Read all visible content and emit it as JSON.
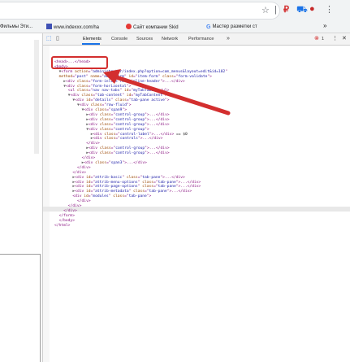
{
  "browser": {
    "bookmarks": [
      {
        "label": "Фильмы Эти..."
      },
      {
        "label": "www.indexxx.com/ha"
      },
      {
        "label": "Сайт компании Skid"
      },
      {
        "label": "Мастер разметки ст"
      }
    ],
    "more": "»"
  },
  "devtools": {
    "tabs": [
      "Elements",
      "Console",
      "Sources",
      "Network",
      "Performance",
      "»"
    ],
    "error_count": "1",
    "dom_lines": [
      {
        "i": 0,
        "parts": [
          [
            "tg",
            "<head>...</head>"
          ]
        ]
      },
      {
        "i": 0,
        "parts": [
          [
            "tg",
            "<body>"
          ]
        ]
      },
      {
        "i": 1,
        "parts": [
          [
            "arr",
            "▼"
          ],
          [
            "tg",
            "<form "
          ],
          [
            "an",
            "action"
          ],
          [
            "tg",
            "=\""
          ],
          [
            "av",
            "administrator/index.php?option=com_menus&layout=edit&id=102"
          ],
          [
            "tg",
            "\""
          ]
        ]
      },
      {
        "i": 1,
        "parts": [
          [
            "an",
            "method"
          ],
          [
            "tg",
            "=\""
          ],
          [
            "av",
            "post"
          ],
          [
            "tg",
            "\" "
          ],
          [
            "an",
            "name"
          ],
          [
            "tg",
            "=\""
          ],
          [
            "av",
            "adminForm"
          ],
          [
            "tg",
            "\" "
          ],
          [
            "an",
            "id"
          ],
          [
            "tg",
            "=\""
          ],
          [
            "av",
            "item-form"
          ],
          [
            "tg",
            "\" "
          ],
          [
            "an",
            "class"
          ],
          [
            "tg",
            "=\""
          ],
          [
            "av",
            "form-validate"
          ],
          [
            "tg",
            "\">"
          ]
        ]
      },
      {
        "i": 2,
        "parts": [
          [
            "arr",
            "▶"
          ],
          [
            "tg",
            "<div "
          ],
          [
            "an",
            "class"
          ],
          [
            "tg",
            "=\""
          ],
          [
            "av",
            "form-inline form-inline-header"
          ],
          [
            "tg",
            "\">...</div>"
          ]
        ]
      },
      {
        "i": 2,
        "parts": [
          [
            "arr",
            "▼"
          ],
          [
            "tg",
            "<div "
          ],
          [
            "an",
            "class"
          ],
          [
            "tg",
            "=\""
          ],
          [
            "av",
            "form-horizontal"
          ],
          [
            "tg",
            "\">"
          ]
        ]
      },
      {
        "i": 3,
        "parts": [
          [
            "tg",
            "<ul "
          ],
          [
            "an",
            "class"
          ],
          [
            "tg",
            "=\""
          ],
          [
            "av",
            "nav nav-tabs"
          ],
          [
            "tg",
            "\" "
          ],
          [
            "an",
            "id"
          ],
          [
            "tg",
            "=\""
          ],
          [
            "av",
            "myTabTabs"
          ],
          [
            "tg",
            "\"></ul>"
          ]
        ]
      },
      {
        "i": 3,
        "parts": [
          [
            "arr",
            "▼"
          ],
          [
            "tg",
            "<div "
          ],
          [
            "an",
            "class"
          ],
          [
            "tg",
            "=\""
          ],
          [
            "av",
            "tab-content"
          ],
          [
            "tg",
            "\" "
          ],
          [
            "an",
            "id"
          ],
          [
            "tg",
            "=\""
          ],
          [
            "av",
            "myTabContent"
          ],
          [
            "tg",
            "\">"
          ]
        ]
      },
      {
        "i": 4,
        "parts": [
          [
            "arr",
            "▼"
          ],
          [
            "tg",
            "<div "
          ],
          [
            "an",
            "id"
          ],
          [
            "tg",
            "=\""
          ],
          [
            "av",
            "details"
          ],
          [
            "tg",
            "\" "
          ],
          [
            "an",
            "class"
          ],
          [
            "tg",
            "=\""
          ],
          [
            "av",
            "tab-pane active"
          ],
          [
            "tg",
            "\">"
          ]
        ]
      },
      {
        "i": 5,
        "parts": [
          [
            "arr",
            "▼"
          ],
          [
            "tg",
            "<div "
          ],
          [
            "an",
            "class"
          ],
          [
            "tg",
            "=\""
          ],
          [
            "av",
            "row-fluid"
          ],
          [
            "tg",
            "\">"
          ]
        ]
      },
      {
        "i": 6,
        "parts": [
          [
            "arr",
            "▼"
          ],
          [
            "tg",
            "<div "
          ],
          [
            "an",
            "class"
          ],
          [
            "tg",
            "=\""
          ],
          [
            "av",
            "span9"
          ],
          [
            "tg",
            "\">"
          ]
        ]
      },
      {
        "i": 7,
        "parts": [
          [
            "arr",
            "▶"
          ],
          [
            "tg",
            "<div "
          ],
          [
            "an",
            "class"
          ],
          [
            "tg",
            "=\""
          ],
          [
            "av",
            "control-group"
          ],
          [
            "tg",
            "\">...</div>"
          ]
        ]
      },
      {
        "i": 7,
        "parts": [
          [
            "arr",
            "▶"
          ],
          [
            "tg",
            "<div "
          ],
          [
            "an",
            "class"
          ],
          [
            "tg",
            "=\""
          ],
          [
            "av",
            "control-group"
          ],
          [
            "tg",
            "\">...</div>"
          ]
        ]
      },
      {
        "i": 7,
        "parts": [
          [
            "arr",
            "▶"
          ],
          [
            "tg",
            "<div "
          ],
          [
            "an",
            "class"
          ],
          [
            "tg",
            "=\""
          ],
          [
            "av",
            "control-group"
          ],
          [
            "tg",
            "\">...</div>"
          ]
        ]
      },
      {
        "i": 7,
        "parts": [
          [
            "arr",
            "▼"
          ],
          [
            "tg",
            "<div "
          ],
          [
            "an",
            "class"
          ],
          [
            "tg",
            "=\""
          ],
          [
            "av",
            "control-group"
          ],
          [
            "tg",
            "\">"
          ]
        ]
      },
      {
        "i": 8,
        "parts": [
          [
            "arr",
            "▶"
          ],
          [
            "tg",
            "<div "
          ],
          [
            "an",
            "class"
          ],
          [
            "tg",
            "=\""
          ],
          [
            "av",
            "control-label"
          ],
          [
            "tg",
            "\">...</div>"
          ],
          [
            "tx",
            " == $0"
          ]
        ]
      },
      {
        "i": 8,
        "parts": [
          [
            "arr",
            "▶"
          ],
          [
            "tg",
            "<div "
          ],
          [
            "an",
            "class"
          ],
          [
            "tg",
            "=\""
          ],
          [
            "av",
            "controls"
          ],
          [
            "tg",
            "\">...</div>"
          ]
        ]
      },
      {
        "i": 7,
        "parts": [
          [
            "tg",
            "</div>"
          ]
        ]
      },
      {
        "i": 7,
        "parts": [
          [
            "arr",
            "▶"
          ],
          [
            "tg",
            "<div "
          ],
          [
            "an",
            "class"
          ],
          [
            "tg",
            "=\""
          ],
          [
            "av",
            "control-group"
          ],
          [
            "tg",
            "\">...</div>"
          ]
        ]
      },
      {
        "i": 7,
        "parts": [
          [
            "arr",
            "▶"
          ],
          [
            "tg",
            "<div "
          ],
          [
            "an",
            "class"
          ],
          [
            "tg",
            "=\""
          ],
          [
            "av",
            "control-group"
          ],
          [
            "tg",
            "\">...</div>"
          ]
        ]
      },
      {
        "i": 6,
        "parts": [
          [
            "tg",
            "</div>"
          ]
        ]
      },
      {
        "i": 6,
        "parts": [
          [
            "arr",
            "▶"
          ],
          [
            "tg",
            "<div "
          ],
          [
            "an",
            "class"
          ],
          [
            "tg",
            "=\""
          ],
          [
            "av",
            "span3"
          ],
          [
            "tg",
            "\">...</div>"
          ]
        ]
      },
      {
        "i": 5,
        "parts": [
          [
            "tg",
            "</div>"
          ]
        ]
      },
      {
        "i": 4,
        "parts": [
          [
            "tg",
            "</div>"
          ]
        ]
      },
      {
        "i": 4,
        "parts": [
          [
            "arr",
            "▶"
          ],
          [
            "tg",
            "<div "
          ],
          [
            "an",
            "id"
          ],
          [
            "tg",
            "=\""
          ],
          [
            "av",
            "attrib-basic"
          ],
          [
            "tg",
            "\" "
          ],
          [
            "an",
            "class"
          ],
          [
            "tg",
            "=\""
          ],
          [
            "av",
            "tab-pane"
          ],
          [
            "tg",
            "\">...</div>"
          ]
        ]
      },
      {
        "i": 4,
        "parts": [
          [
            "arr",
            "▶"
          ],
          [
            "tg",
            "<div "
          ],
          [
            "an",
            "id"
          ],
          [
            "tg",
            "=\""
          ],
          [
            "av",
            "attrib-menu-options"
          ],
          [
            "tg",
            "\" "
          ],
          [
            "an",
            "class"
          ],
          [
            "tg",
            "=\""
          ],
          [
            "av",
            "tab-pane"
          ],
          [
            "tg",
            "\">...</div>"
          ]
        ]
      },
      {
        "i": 4,
        "parts": [
          [
            "arr",
            "▶"
          ],
          [
            "tg",
            "<div "
          ],
          [
            "an",
            "id"
          ],
          [
            "tg",
            "=\""
          ],
          [
            "av",
            "attrib-page-options"
          ],
          [
            "tg",
            "\" "
          ],
          [
            "an",
            "class"
          ],
          [
            "tg",
            "=\""
          ],
          [
            "av",
            "tab-pane"
          ],
          [
            "tg",
            "\">...</div>"
          ]
        ]
      },
      {
        "i": 4,
        "parts": [
          [
            "arr",
            "▶"
          ],
          [
            "tg",
            "<div "
          ],
          [
            "an",
            "id"
          ],
          [
            "tg",
            "=\""
          ],
          [
            "av",
            "attrib-metadata"
          ],
          [
            "tg",
            "\" "
          ],
          [
            "an",
            "class"
          ],
          [
            "tg",
            "=\""
          ],
          [
            "av",
            "tab-pane"
          ],
          [
            "tg",
            "\">...</div>"
          ]
        ]
      },
      {
        "i": 4,
        "parts": [
          [
            "tg",
            "<div "
          ],
          [
            "an",
            "id"
          ],
          [
            "tg",
            "=\""
          ],
          [
            "av",
            "modules"
          ],
          [
            "tg",
            "\" "
          ],
          [
            "an",
            "class"
          ],
          [
            "tg",
            "=\""
          ],
          [
            "av",
            "tab-pane"
          ],
          [
            "tg",
            "\">"
          ]
        ]
      },
      {
        "i": 5,
        "parts": [
          [
            "tg",
            "</div>"
          ]
        ]
      },
      {
        "i": 3,
        "parts": [
          [
            "tg",
            "</div>"
          ]
        ]
      },
      {
        "i": 2,
        "parts": [
          [
            "tg",
            "</div>"
          ]
        ]
      },
      {
        "i": 1,
        "parts": [
          [
            "tg",
            "</form>"
          ]
        ]
      },
      {
        "i": 1,
        "parts": [
          [
            "tg",
            "</body>"
          ]
        ]
      },
      {
        "i": 0,
        "parts": [
          [
            "tg",
            "</html>"
          ]
        ]
      }
    ]
  },
  "colors": {
    "highlight": "#d32f2f",
    "accent": "#1a73e8"
  }
}
